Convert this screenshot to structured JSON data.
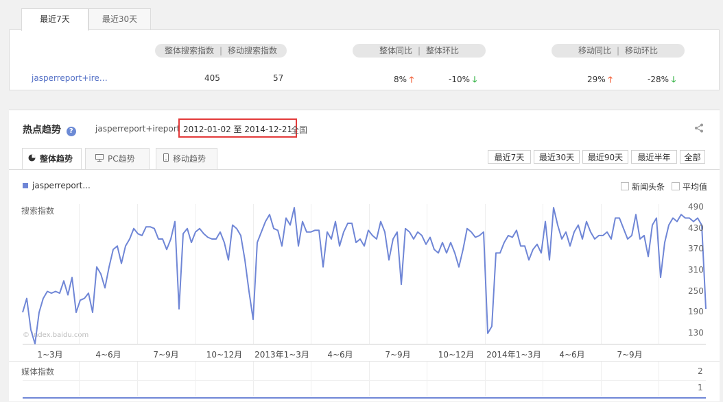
{
  "top_tabs": [
    "最近7天",
    "最近30天"
  ],
  "top_headers": {
    "overall_search": "整体搜索指数",
    "mobile_search": "移动搜索指数",
    "overall_yoy": "整体同比",
    "overall_mom": "整体环比",
    "mobile_yoy": "移动同比",
    "mobile_mom": "移动环比",
    "sep": "|"
  },
  "top_row": {
    "keyword": "jasperreport+ire…",
    "overall_search": "405",
    "mobile_search": "57",
    "overall_yoy": "8%",
    "overall_mom": "-10%",
    "mobile_yoy": "29%",
    "mobile_mom": "-28%",
    "up_arrow": "🡑",
    "down_arrow": "🡓"
  },
  "trend": {
    "title": "热点趋势",
    "help_icon": "?",
    "keyword": "jasperreport+ireport",
    "date_range": "2012-01-02 至 2014-12-21",
    "region": "全国",
    "share_icon": "share-icon"
  },
  "chart_tabs": [
    "整体趋势",
    "PC趋势",
    "移动趋势"
  ],
  "range_buttons": [
    "最近7天",
    "最近30天",
    "最近90天",
    "最近半年",
    "全部"
  ],
  "legend": {
    "series": "jasperreport...",
    "news_checkbox": "新闻头条",
    "avg_checkbox": "平均值"
  },
  "watermark": "© index.baidu.com",
  "media_label": "媒体指数",
  "media_ticks": [
    "2",
    "1"
  ],
  "colors": {
    "line": "#6f86d6",
    "highlight": "#e33a3a",
    "up": "#f2623b",
    "down": "#3ab54a"
  },
  "chart_data": {
    "type": "line",
    "ylabel": "搜索指数",
    "ylim": [
      100,
      500
    ],
    "yticks": [
      490,
      430,
      370,
      310,
      250,
      190,
      130
    ],
    "xticks": [
      "1~3月",
      "4~6月",
      "7~9月",
      "10~12月",
      "2013年1~3月",
      "4~6月",
      "7~9月",
      "10~12月",
      "2014年1~3月",
      "4~6月",
      "7~9月"
    ],
    "series": [
      {
        "name": "jasperreport...",
        "values": [
          190,
          230,
          140,
          100,
          190,
          230,
          250,
          245,
          250,
          245,
          280,
          240,
          290,
          190,
          225,
          230,
          245,
          190,
          320,
          300,
          260,
          320,
          370,
          380,
          330,
          380,
          400,
          430,
          415,
          410,
          435,
          435,
          430,
          400,
          400,
          370,
          400,
          450,
          200,
          415,
          430,
          390,
          420,
          430,
          415,
          405,
          400,
          400,
          420,
          390,
          340,
          440,
          430,
          410,
          340,
          250,
          170,
          390,
          420,
          450,
          470,
          430,
          425,
          380,
          460,
          440,
          490,
          380,
          450,
          420,
          420,
          425,
          425,
          320,
          420,
          400,
          450,
          380,
          420,
          445,
          445,
          390,
          400,
          380,
          425,
          410,
          400,
          450,
          420,
          340,
          400,
          420,
          270,
          430,
          420,
          400,
          420,
          410,
          385,
          405,
          370,
          360,
          390,
          360,
          390,
          360,
          320,
          370,
          430,
          420,
          405,
          410,
          420,
          130,
          150,
          360,
          360,
          390,
          410,
          405,
          425,
          380,
          380,
          340,
          370,
          385,
          360,
          450,
          340,
          490,
          440,
          400,
          420,
          380,
          420,
          440,
          400,
          450,
          420,
          400,
          410,
          410,
          420,
          400,
          460,
          460,
          430,
          400,
          410,
          470,
          400,
          410,
          350,
          440,
          460,
          290,
          390,
          440,
          460,
          450,
          470,
          460,
          460,
          450,
          460,
          440,
          200
        ]
      }
    ]
  }
}
